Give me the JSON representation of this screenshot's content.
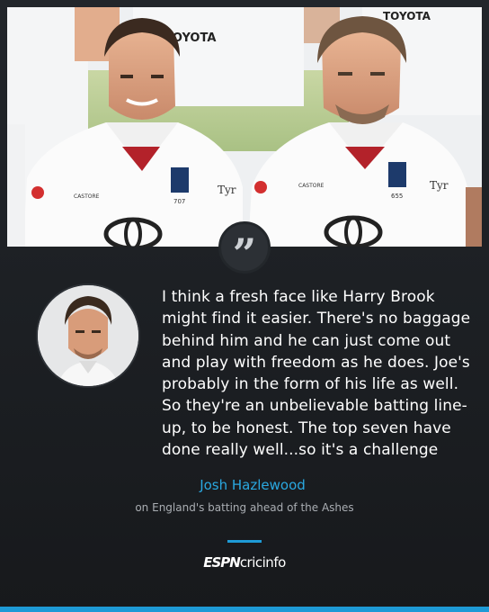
{
  "quote": {
    "text": "I think a fresh face like Harry Brook might find it easier. There's no baggage behind him and he can just come out and play with freedom as he does. Joe's probably in the form of his life as well. So they're an unbelievable batting line-up, to be honest. The top seven have done really well...so it's a challenge",
    "mark": "”"
  },
  "speaker": {
    "name": "Josh Hazlewood",
    "context": "on England's batting ahead of the Ashes"
  },
  "brand": {
    "espn": "ESPN",
    "cricinfo": "cricinfo"
  },
  "photo": {
    "sponsor_left": "TOYOTA",
    "sponsor_right": "TOYOTA",
    "kit_brand": "CASTORE",
    "player_left_number": "707",
    "player_right_number": "655",
    "sleeve_sponsor": "Tyr"
  },
  "colors": {
    "accent": "#1e9ad6",
    "speaker": "#2aa8e0",
    "background": "#1c1f23"
  }
}
